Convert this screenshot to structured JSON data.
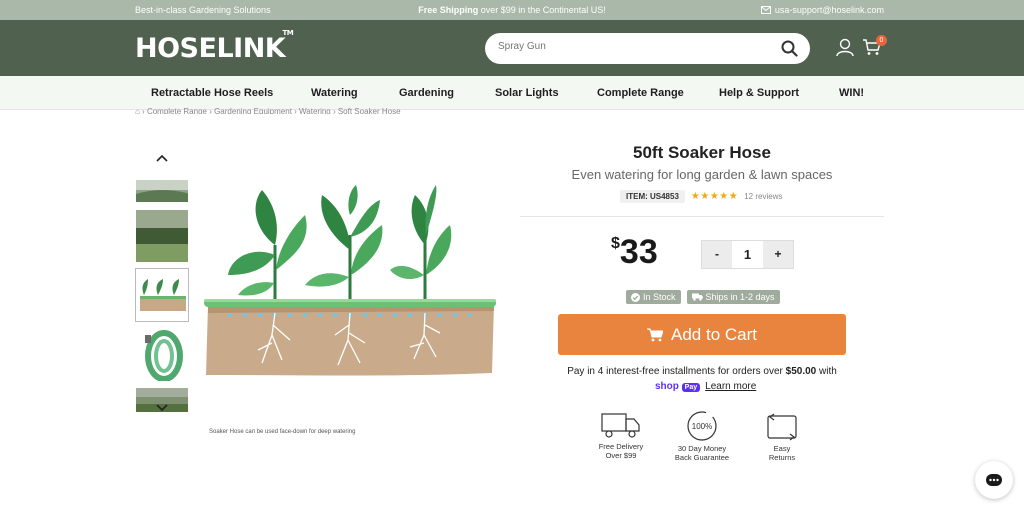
{
  "announcement": {
    "left": "Best-in-class Gardening Solutions",
    "center_bold": "Free Shipping",
    "center_rest": " over $99 in the Continental US!",
    "email": "usa-support@hoselink.com"
  },
  "header": {
    "logo": "HOSELINK",
    "logo_tm": "TM",
    "search_placeholder": "Spray Gun",
    "cart_count": "0"
  },
  "nav": {
    "items": [
      "Retractable Hose Reels",
      "Watering",
      "Gardening",
      "Solar Lights",
      "Complete Range",
      "Help & Support",
      "WIN!"
    ]
  },
  "breadcrumb": "⌂  ›  Complete Range  ›  Gardening Equipment  ›  Watering  ›  Soft Soaker Hose",
  "gallery": {
    "caption": "Soaker Hose can be used face-down for deep watering"
  },
  "product": {
    "title": "50ft Soaker Hose",
    "subtitle": "Even watering for long garden & lawn spaces",
    "item_code": "ITEM: US4853",
    "rating_stars": "★★★★★",
    "rating": 5,
    "reviews": "12 reviews",
    "currency": "$",
    "price": "33",
    "qty_minus": "-",
    "qty_value": "1",
    "qty_plus": "+",
    "in_stock": "In Stock",
    "ships": "Ships in 1-2 days",
    "add_to_cart": "Add to Cart",
    "installments_text": "Pay in 4 interest-free installments for orders over ",
    "installments_amount": "$50.00",
    "installments_suffix": " with",
    "shop_label": "shop",
    "pay_label": "Pay",
    "learn_more": "Learn more"
  },
  "perks": [
    {
      "line1": "Free Delivery",
      "line2": "Over $99"
    },
    {
      "badge": "100%",
      "line1": "30 Day Money",
      "line2": "Back Guarantee"
    },
    {
      "line1": "Easy",
      "line2": "Returns"
    }
  ],
  "colors": {
    "announcement_bg": "#a9b8a9",
    "header_bg": "#50614f",
    "nav_bg": "#f3f8f2",
    "accent": "#e8843e",
    "badge_bg": "#9fab9c",
    "star": "#f0a81a",
    "cart_badge": "#e8643a"
  }
}
